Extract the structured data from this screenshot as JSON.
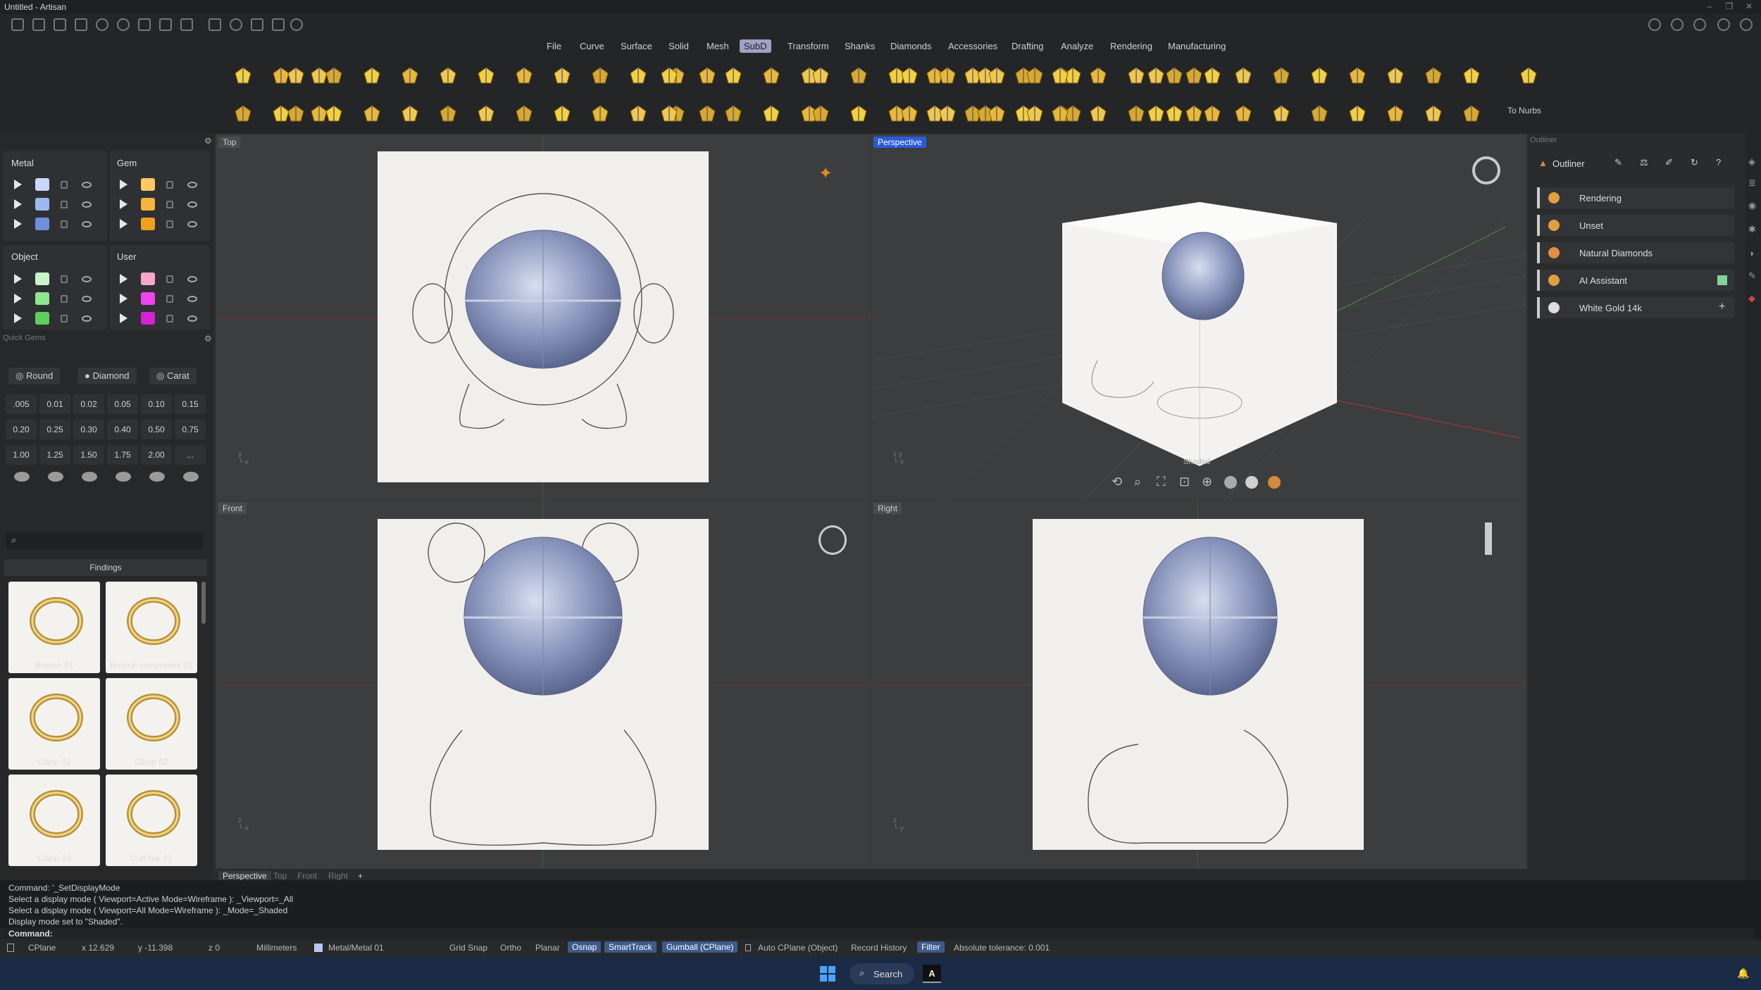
{
  "app": {
    "title": "Untitled - Artisan"
  },
  "menu": {
    "items": [
      "File",
      "Curve",
      "Surface",
      "Solid",
      "Mesh",
      "SubD",
      "Transform",
      "Shanks",
      "Diamonds",
      "Accessories",
      "Drafting",
      "Analyze",
      "Rendering",
      "Manufacturing"
    ],
    "active": "SubD"
  },
  "toolbar": {
    "to_nurbs_label": "To Nurbs"
  },
  "layers": {
    "metal": {
      "title": "Metal",
      "colors": [
        "#c9d6ff",
        "#9fb7f2",
        "#6f8fdc"
      ]
    },
    "gem": {
      "title": "Gem",
      "colors": [
        "#ffc864",
        "#f5b43c",
        "#f0a020"
      ]
    },
    "object": {
      "title": "Object",
      "colors": [
        "#c8f5c8",
        "#8ee68e",
        "#5ccf5c"
      ]
    },
    "user": {
      "title": "User",
      "colors": [
        "#f5a8c8",
        "#ee44ee",
        "#d422d4"
      ]
    }
  },
  "quick_gems": {
    "title": "Quick Gems",
    "cuts": [
      "Round",
      "Diamond",
      "Carat"
    ],
    "carats": [
      ".005",
      "0.01",
      "0.02",
      "0.05",
      "0.10",
      "0.15",
      "0.20",
      "0.25",
      "0.30",
      "0.40",
      "0.50",
      "0.75",
      "1.00",
      "1.25",
      "1.50",
      "1.75",
      "2.00",
      "..."
    ]
  },
  "library": {
    "category": "Findings",
    "items": [
      "Brooch 01",
      "Brooch component 01",
      "Clasp 01",
      "Clasp 02",
      "Clasp 03",
      "Cuff link 01"
    ]
  },
  "viewports": {
    "top": "Top",
    "perspective": "Perspective",
    "front": "Front",
    "right": "Right",
    "display_mode_label": "Shaded"
  },
  "viewport_tabs": [
    "Perspective",
    "Top",
    "Front",
    "Right",
    "+"
  ],
  "outliner": {
    "title": "Outliner",
    "panel_caption": "Outliner",
    "rows": [
      "Rendering",
      "Unset",
      "Natural Diamonds",
      "AI Assistant",
      "White Gold 14k"
    ]
  },
  "command": {
    "history": [
      "Command: '_SetDisplayMode",
      "Select a display mode ( Viewport=Active  Mode=Wireframe ): _Viewport=_All",
      "Select a display mode ( Viewport=All  Mode=Wireframe ): _Mode=_Shaded",
      "Display mode set to \"Shaded\"."
    ],
    "prompt": "Command:"
  },
  "status": {
    "cplane": "CPlane",
    "x": "x 12.629",
    "y": "y -11.398",
    "z": "z 0",
    "units": "Millimeters",
    "layer": "Metal/Metal 01",
    "grid_snap": "Grid Snap",
    "ortho": "Ortho",
    "planar": "Planar",
    "osnap": "Osnap",
    "smarttrack": "SmartTrack",
    "gumball": "Gumball (CPlane)",
    "auto_cplane": "Auto CPlane (Object)",
    "record_history": "Record History",
    "filter": "Filter",
    "tolerance": "Absolute tolerance: 0.001"
  },
  "taskbar": {
    "search": "Search"
  }
}
